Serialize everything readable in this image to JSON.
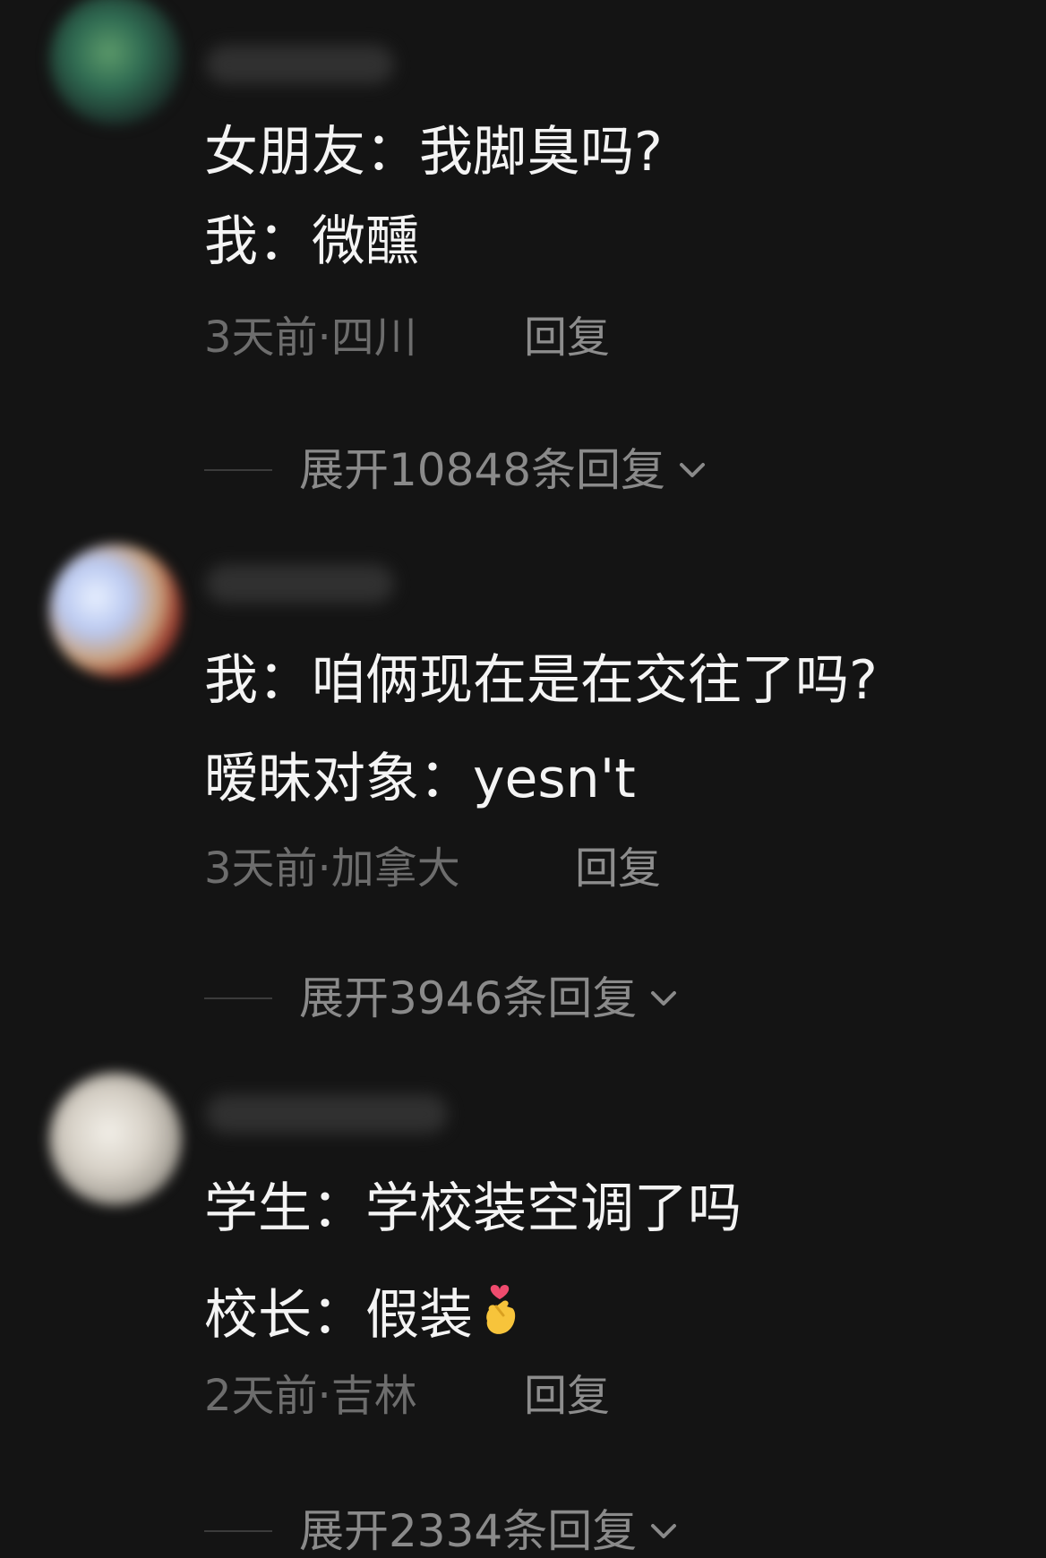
{
  "comments": [
    {
      "lines": [
        "女朋友：我脚臭吗?",
        "我：微醺"
      ],
      "meta": "3天前·四川",
      "reply_label": "回复",
      "expand_label": "展开10848条回复"
    },
    {
      "lines": [
        "我：咱俩现在是在交往了吗?",
        "暧昧对象：yesn't"
      ],
      "meta": "3天前·加拿大",
      "reply_label": "回复",
      "expand_label": "展开3946条回复"
    },
    {
      "lines": [
        "学生：学校装空调了吗",
        "校长：假装"
      ],
      "meta": "2天前·吉林",
      "reply_label": "回复",
      "expand_label": "展开2334条回复"
    }
  ],
  "icons": {
    "expand": "chevron-down-icon",
    "emoji": "finger-heart-emoji-icon"
  },
  "colors": {
    "background": "#141414",
    "text": "#f4f4f4",
    "meta": "#6d6d6d",
    "reply": "#8d8d8d"
  }
}
